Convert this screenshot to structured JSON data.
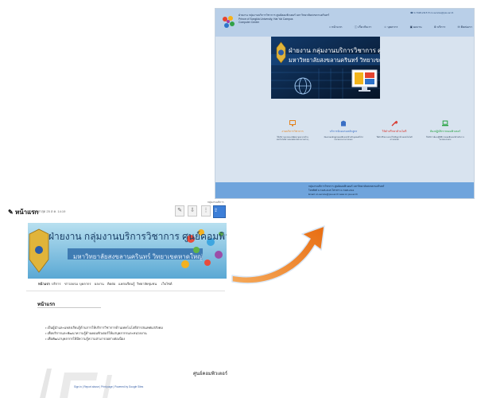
{
  "new_site": {
    "header_title_lines": [
      "ฝ่ายงาน กลุ่มงานบริการวิชาการ ศูนย์คอมพิวเตอร์ มหาวิทยาลัยสงขลานครินทร์",
      "Prince of Songkla University, Hat Yai Campus",
      "Computer Center"
    ],
    "top_info": "☎ 0-7428-2115   ✉ cc-service@psu.ac.th",
    "nav": [
      {
        "label": "หน้าแรก",
        "icon": "home-icon"
      },
      {
        "label": "เกี่ยวกับเรา",
        "icon": "info-icon"
      },
      {
        "label": "บุคลากร",
        "icon": "people-icon"
      },
      {
        "label": "ผลงาน",
        "icon": "briefcase-icon"
      },
      {
        "label": "บริการ",
        "icon": "wrench-icon"
      },
      {
        "label": "ติดต่อเรา",
        "icon": "mail-icon"
      }
    ],
    "banner": {
      "line1": "ฝ่ายงาน กลุ่มงานบริการวิชาการ ศูนย์คอมพิวเตอร์ ม.อ.",
      "line2": "มหาวิทยาลัยสงขลานครินทร์ วิทยาเขตหาดใหญ่"
    },
    "features": [
      {
        "title": "งานบริการวิชาการ",
        "desc": "ให้บริการอบรมและพัฒนาบุคลากรด้านเทคโนโลยีสารสนเทศแก่หน่วยงานต่างๆ",
        "color": "#e4831e",
        "icon": "monitor-icon"
      },
      {
        "title": "บริการจัดอบรมหลักสูตร",
        "desc": "จัดอบรมหลักสูตรคอมพิวเตอร์สำหรับบุคคลทั่วไปและหน่วยงานภายนอก",
        "color": "#3a6fc4",
        "icon": "building-icon"
      },
      {
        "title": "ให้คำปรึกษาด้านไอที",
        "desc": "ให้คำปรึกษาและแก้ไขปัญหาด้านเทคโนโลยีสารสนเทศ",
        "color": "#d9352b",
        "icon": "wrench-icon"
      },
      {
        "title": "ห้องปฏิบัติการคอมพิวเตอร์",
        "desc": "ให้บริการห้องปฏิบัติการคอมพิวเตอร์สำหรับการอบรมและสอบ",
        "color": "#27a243",
        "icon": "laptop-icon"
      }
    ],
    "footer": {
      "line1": "กลุ่มงานบริการวิชาการ ศูนย์คอมพิวเตอร์ มหาวิทยาลัยสงขลานครินทร์",
      "line2": "โทรศัพท์ 0-7428-2115 โทรสาร 0-7428-2111",
      "line3": "Email: cc-service@psu.ac.th   www.cc.psu.ac.th"
    }
  },
  "old_site": {
    "tab_label": "หน้าแรก",
    "updated": "อัปเดตล่าสุด 25 ส.ค. 14:19",
    "top_right_text": "กลุ่มงานบริการ",
    "buttons": {
      "edit": "✎",
      "pin": "⇩",
      "share": "⇪"
    },
    "banner": {
      "line1": "ฝ่ายงาน กลุ่มงานบริการวิชาการ ศูนย์คอมพิวเตอร์ ม.อ.",
      "line2": "มหาวิทยาลัยสงขลานครินทร์ วิทยาเขตหาดใหญ่"
    },
    "nav": [
      "หน้าแรก",
      "บริการ",
      "ข่าวอบรม",
      "บุคลากร",
      "ผลงาน",
      "ติดต่อ",
      "แหล่งเรียนรู้",
      "วิทยาลัยชุมชน",
      "เว็บไซต์"
    ],
    "heading": "หน้าแรก",
    "bullets": [
      "เป็นผู้นำและแหล่งเรียนรู้ด้านการให้บริการวิชาการด้านเทคโนโลยีสารสนเทศแก่สังคม",
      "เพื่อบริการและพัฒนาความรู้ด้านคอมพิวเตอร์ให้แก่บุคลากรและหน่วยงาน",
      "เพื่อพัฒนาบุคลากรให้มีความรู้ความสามารถอย่างต่อเนื่อง"
    ],
    "signature": "ศูนย์คอมพิวเตอร์",
    "footer": "Sign in  |  Report abuse  |  Print page  |  Powered by Google Sites"
  },
  "colors": {
    "new_header": "#b9cfe8",
    "new_footer": "#6fa4dc",
    "arrow": "#f07a1a"
  }
}
